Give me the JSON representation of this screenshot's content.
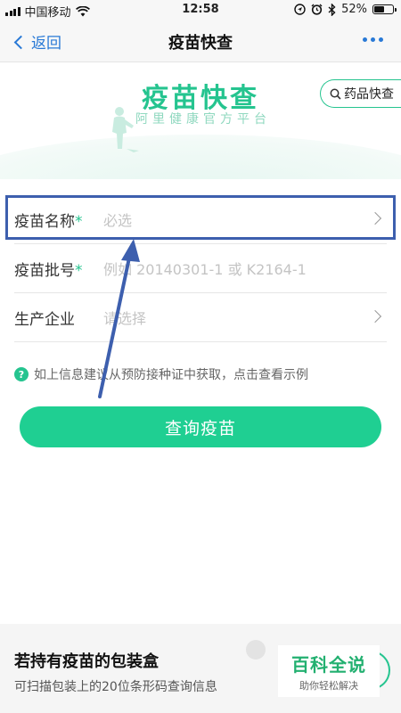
{
  "status_bar": {
    "carrier": "中国移动",
    "time": "12:58",
    "battery_percent": "52%",
    "battery_level": 0.52
  },
  "nav": {
    "back_label": "返回",
    "title": "疫苗快查"
  },
  "banner": {
    "title": "疫苗快查",
    "subtitle": "阿里健康官方平台",
    "drug_check_label": "药品快查"
  },
  "form": {
    "rows": [
      {
        "label": "疫苗名称",
        "required_mark": "*",
        "placeholder": "必选",
        "has_chevron": true
      },
      {
        "label": "疫苗批号",
        "required_mark": "*",
        "placeholder": "例如 20140301-1 或 K2164-1",
        "has_chevron": false
      },
      {
        "label": "生产企业",
        "required_mark": "",
        "placeholder": "请选择",
        "has_chevron": true
      }
    ],
    "hint_icon": "?",
    "hint": "如上信息建议从预防接种证中获取，点击查看示例",
    "submit_label": "查询疫苗"
  },
  "bottom_card": {
    "title": "若持有疫苗的包装盒",
    "subtitle": "可扫描包装上的20位条形码查询信息"
  },
  "watermark": {
    "main": "百科全说",
    "sub": "助你轻松解决"
  },
  "colors": {
    "accent_green": "#1fcf92",
    "link_blue": "#2979d6",
    "annotation_blue": "#3d5fae"
  },
  "icons": [
    "wifi-icon",
    "location-icon",
    "alarm-icon",
    "bluetooth-icon",
    "battery-icon",
    "back-chevron-icon",
    "more-icon",
    "search-icon",
    "chevron-right-icon",
    "help-icon",
    "scan-icon"
  ]
}
